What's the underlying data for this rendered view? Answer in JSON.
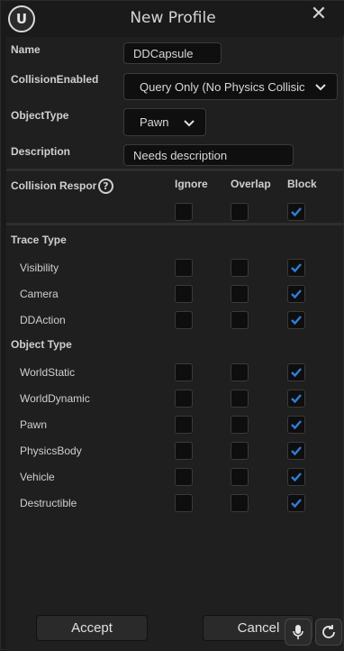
{
  "window": {
    "title": "New Profile"
  },
  "form": {
    "name_label": "Name",
    "name_value": "DDCapsule",
    "collision_enabled_label": "CollisionEnabled",
    "collision_enabled_value": "Query Only (No Physics Collisic",
    "object_type_label": "ObjectType",
    "object_type_value": "Pawn",
    "description_label": "Description",
    "description_value": "Needs description"
  },
  "responses": {
    "header_label": "Collision Respor",
    "columns": [
      "Ignore",
      "Overlap",
      "Block"
    ],
    "all": [
      false,
      false,
      true
    ],
    "trace_type_label": "Trace Type",
    "trace_rows": [
      {
        "label": "Visibility",
        "checks": [
          false,
          false,
          true
        ]
      },
      {
        "label": "Camera",
        "checks": [
          false,
          false,
          true
        ]
      },
      {
        "label": "DDAction",
        "checks": [
          false,
          false,
          true
        ]
      }
    ],
    "object_type_label": "Object Type",
    "object_rows": [
      {
        "label": "WorldStatic",
        "checks": [
          false,
          false,
          true
        ]
      },
      {
        "label": "WorldDynamic",
        "checks": [
          false,
          false,
          true
        ]
      },
      {
        "label": "Pawn",
        "checks": [
          false,
          false,
          true
        ]
      },
      {
        "label": "PhysicsBody",
        "checks": [
          false,
          false,
          true
        ]
      },
      {
        "label": "Vehicle",
        "checks": [
          false,
          false,
          true
        ]
      },
      {
        "label": "Destructible",
        "checks": [
          false,
          false,
          true
        ]
      }
    ]
  },
  "buttons": {
    "accept": "Accept",
    "cancel": "Cancel"
  },
  "icons": {
    "logo": "unreal-logo-icon",
    "close": "close-icon",
    "help": "help-icon",
    "mic": "microphone-icon",
    "refresh": "refresh-icon"
  },
  "colors": {
    "check": "#2f7fd8",
    "background": "#1f1f1f"
  }
}
